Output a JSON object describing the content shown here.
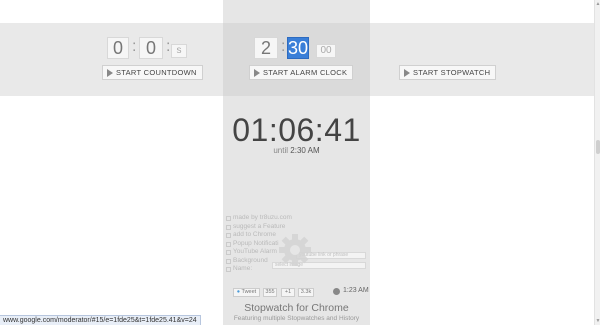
{
  "countdown": {
    "hours": "0",
    "minutes": "0",
    "seconds": "s",
    "button_label": "START  COUNTDOWN"
  },
  "alarm": {
    "hour": "2",
    "minute": "30",
    "second": "00",
    "button_label": "START  ALARM CLOCK"
  },
  "stopwatch": {
    "button_label": "START  STOPWATCH"
  },
  "display": {
    "time": "01:06:41",
    "until_prefix": "until",
    "until_time": "2:30 AM"
  },
  "menu": {
    "items": [
      "made by tr8uzu.com",
      "suggest a Feature",
      "add to Chrome",
      "Popup Notificati",
      "YouTube Alarm",
      "Background",
      "Name:"
    ],
    "youtube_placeholder": "youtube link or phrase",
    "background_placeholder": "select image"
  },
  "social": {
    "tweet_label": "Tweet",
    "tweet_count": "355",
    "gplus_label": "+1",
    "fb_count": "3.3k"
  },
  "current_time": "1:23 AM",
  "footer": {
    "title": "Stopwatch for Chrome",
    "subtitle": "Featuring multiple Stopwatches and History"
  },
  "status_url": "www.google.com/moderator/#15/e=1fde25&t=1fde25.41&v=24",
  "colors": {
    "selection": "#3a7fd8",
    "panel": "#e6e6e6",
    "band": "#e9e9e9"
  }
}
